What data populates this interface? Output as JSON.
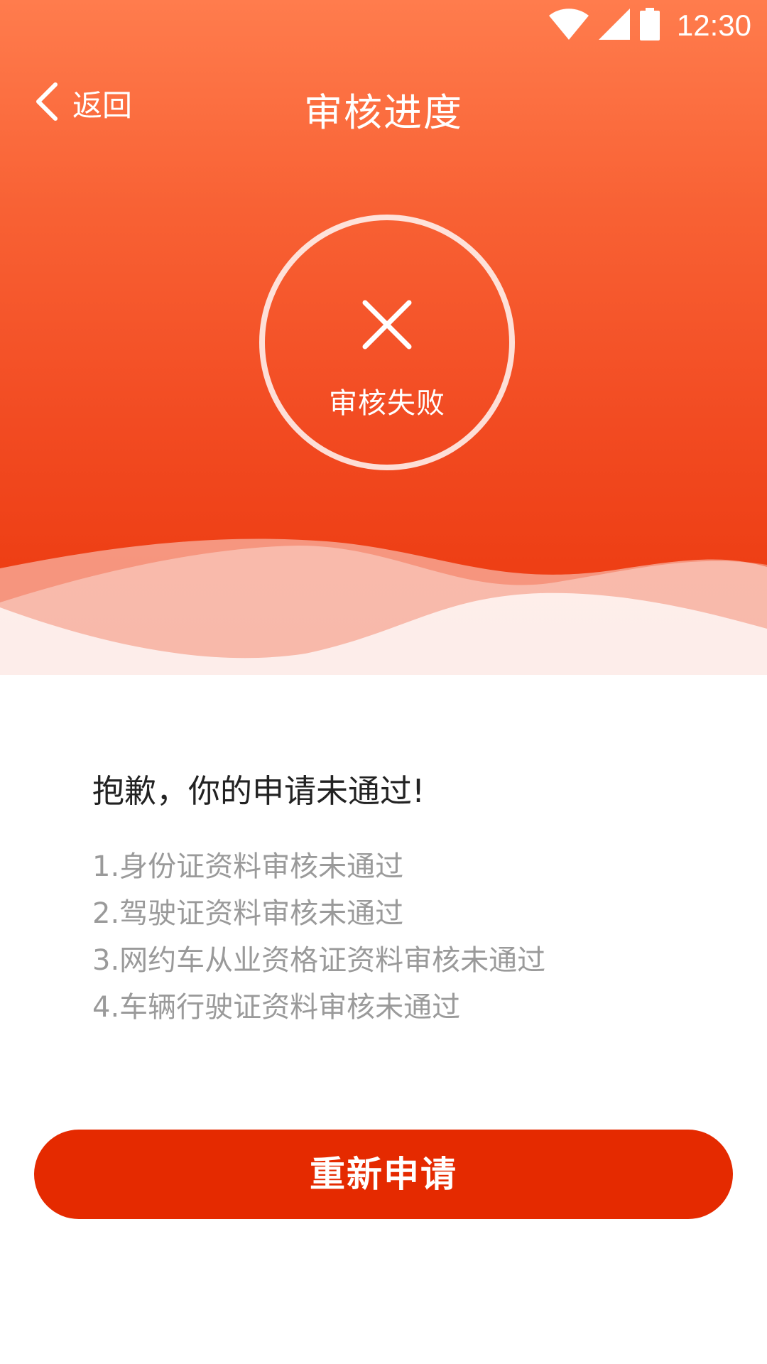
{
  "status_bar": {
    "time": "12:30",
    "icons": [
      "wifi-icon",
      "cell-signal-icon",
      "battery-icon"
    ]
  },
  "nav": {
    "back_label": "返回",
    "title": "审核进度",
    "back_icon": "chevron-left-icon"
  },
  "status": {
    "icon": "close-icon",
    "label": "审核失败"
  },
  "message": {
    "headline": "抱歉，你的申请未通过!",
    "reasons": [
      "1.身份证资料审核未通过",
      "2.驾驶证资料审核未通过",
      "3.网约车从业资格证资料审核未通过",
      "4.车辆行驶证资料审核未通过"
    ]
  },
  "actions": {
    "reapply_label": "重新申请"
  },
  "colors": {
    "header_gradient_top": "#ff7c4d",
    "header_gradient_bottom": "#ec3b12",
    "button": "#e52a00",
    "headline_text": "#222222",
    "reason_text": "#9a9a9a"
  }
}
